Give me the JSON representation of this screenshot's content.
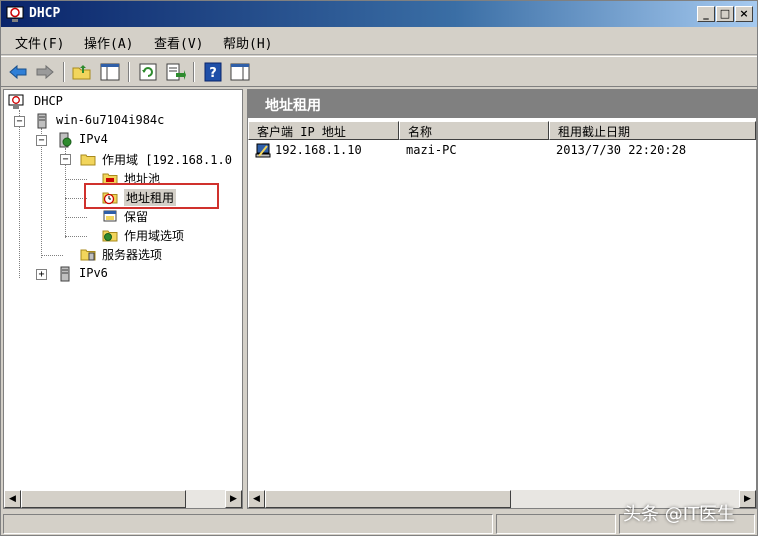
{
  "window": {
    "title": "DHCP"
  },
  "menu": [
    "文件(F)",
    "操作(A)",
    "查看(V)",
    "帮助(H)"
  ],
  "tree": {
    "root": "DHCP",
    "server": "win-6u7104i984c",
    "ipv4": "IPv4",
    "scope": "作用域 [192.168.1.0",
    "address_pool": "地址池",
    "address_leases": "地址租用",
    "reservations": "保留",
    "scope_options": "作用域选项",
    "server_options": "服务器选项",
    "ipv6": "IPv6"
  },
  "right": {
    "header": "地址租用",
    "columns": [
      "客户端 IP 地址",
      "名称",
      "租用截止日期"
    ],
    "rows": [
      {
        "ip": "192.168.1.10",
        "name": "mazi-PC",
        "expires": "2013/7/30 22:20:28"
      }
    ]
  },
  "watermark": "头条 @IT医生",
  "colors": {
    "highlight": "#d0312d",
    "title_bar": "#0a246a",
    "pane_header": "#808080"
  }
}
